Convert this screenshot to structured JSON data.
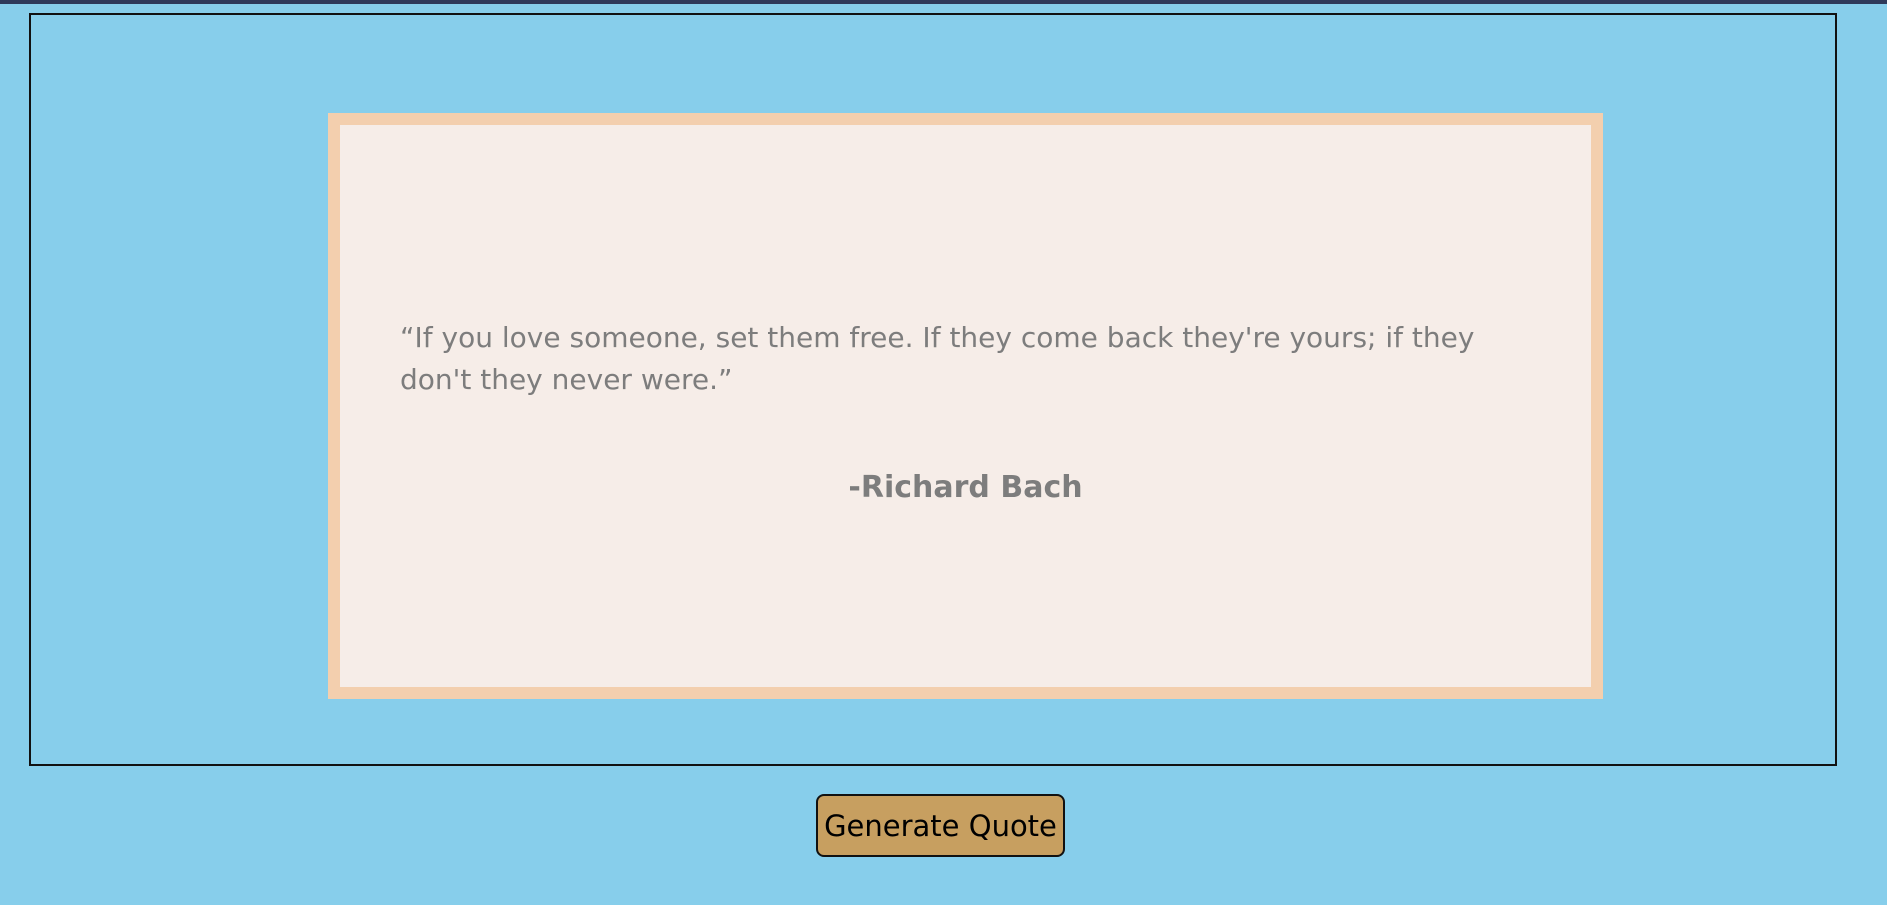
{
  "quote": {
    "text": "“If you love someone, set them free. If they come back they're yours; if they don't they never were.”",
    "author": "-Richard Bach"
  },
  "actions": {
    "generate_label": "Generate Quote"
  },
  "colors": {
    "page_background": "#87ceeb",
    "card_background": "#f6ede8",
    "card_border": "#f3cfae",
    "text": "#7d7d7d",
    "button_background": "#c79f60"
  }
}
